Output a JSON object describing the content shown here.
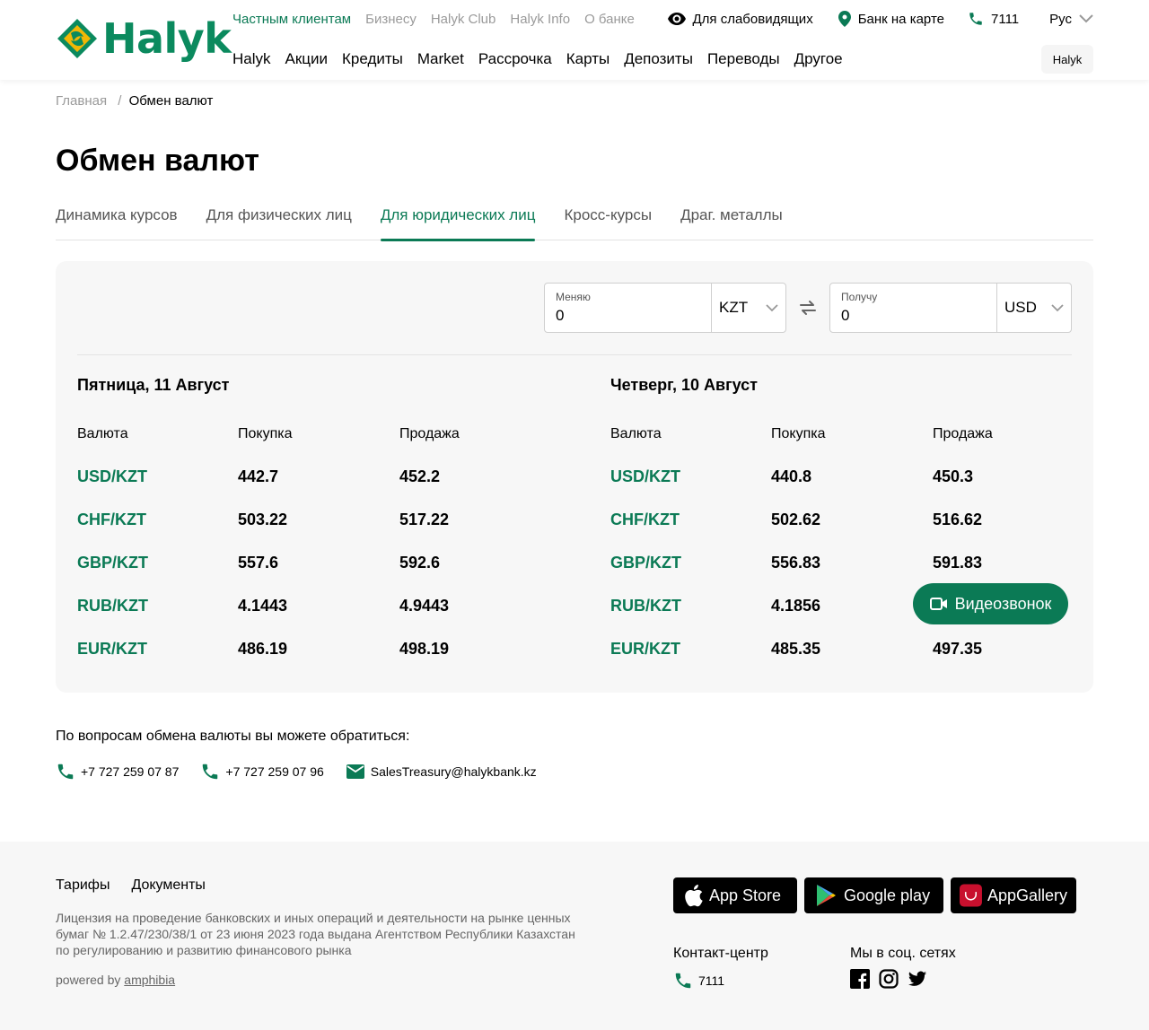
{
  "header": {
    "logo_text": "Halyk",
    "top_nav": [
      "Частным клиентам",
      "Бизнесу",
      "Halyk Club",
      "Halyk Info",
      "О банке"
    ],
    "utils": {
      "low_vision": "Для слабовидящих",
      "map": "Банк на карте",
      "phone": "7111",
      "lang": "Рус"
    },
    "main_nav": [
      "Halyk",
      "Акции",
      "Кредиты",
      "Market",
      "Рассрочка",
      "Карты",
      "Депозиты",
      "Переводы",
      "Другое"
    ],
    "halyk_btn": "Halyk"
  },
  "breadcrumb": {
    "home": "Главная",
    "sep": "/",
    "current": "Обмен валют"
  },
  "page_title": "Обмен валют",
  "tabs": [
    "Динамика курсов",
    "Для физических лиц",
    "Для юридических лиц",
    "Кросс-курсы",
    "Драг. металлы"
  ],
  "converter": {
    "from_label": "Меняю",
    "from_value": "0",
    "from_currency": "KZT",
    "to_label": "Получу",
    "to_value": "0",
    "to_currency": "USD"
  },
  "table_headers": {
    "currency": "Валюта",
    "buy": "Покупка",
    "sell": "Продажа"
  },
  "days": [
    {
      "title": "Пятница, 11 Август",
      "rows": [
        {
          "pair": "USD/KZT",
          "buy": "442.7",
          "sell": "452.2"
        },
        {
          "pair": "CHF/KZT",
          "buy": "503.22",
          "sell": "517.22"
        },
        {
          "pair": "GBP/KZT",
          "buy": "557.6",
          "sell": "592.6"
        },
        {
          "pair": "RUB/KZT",
          "buy": "4.1443",
          "sell": "4.9443"
        },
        {
          "pair": "EUR/KZT",
          "buy": "486.19",
          "sell": "498.19"
        }
      ]
    },
    {
      "title": "Четверг, 10 Август",
      "rows": [
        {
          "pair": "USD/KZT",
          "buy": "440.8",
          "sell": "450.3"
        },
        {
          "pair": "CHF/KZT",
          "buy": "502.62",
          "sell": "516.62"
        },
        {
          "pair": "GBP/KZT",
          "buy": "556.83",
          "sell": "591.83"
        },
        {
          "pair": "RUB/KZT",
          "buy": "4.1856",
          "sell": ""
        },
        {
          "pair": "EUR/KZT",
          "buy": "485.35",
          "sell": "497.35"
        }
      ]
    }
  ],
  "video_call": "Видеозвонок",
  "contacts": {
    "title": "По вопросам обмена валюты вы можете обратиться:",
    "phone1": "+7 727 259 07 87",
    "phone2": "+7 727 259 07 96",
    "email": "SalesTreasury@halykbank.kz"
  },
  "footer": {
    "links": [
      "Тарифы",
      "Документы"
    ],
    "license": "Лицензия на проведение банковских и иных операций и деятельности на рынке ценных бумаг № 1.2.47/230/38/1 от 23 июня 2023 года выдана Агентством Республики Казахстан по регулированию и развитию финансового рынка",
    "powered_prefix": "powered by",
    "powered_link": "amphibia",
    "stores": [
      "App Store",
      "Google play",
      "AppGallery"
    ],
    "contact_center": "Контакт-центр",
    "contact_phone": "7111",
    "social_title": "Мы в соц. сетях"
  },
  "colors": {
    "brand_green": "#0b7a55",
    "accent_yellow": "#f2b705"
  }
}
